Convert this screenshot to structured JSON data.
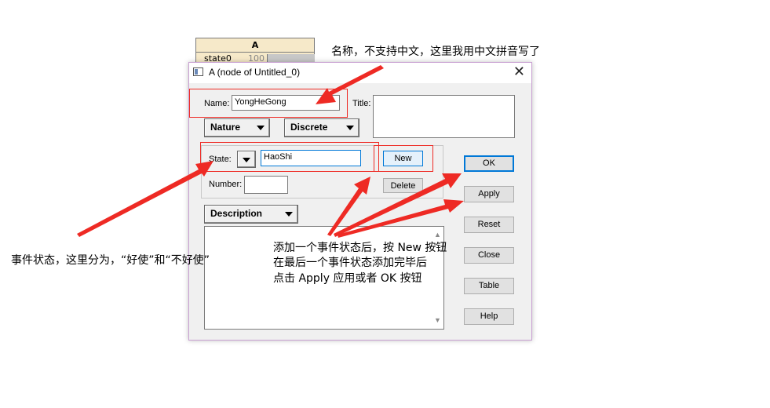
{
  "node": {
    "title": "A",
    "state_label": "state0",
    "state_value": "100"
  },
  "dialog": {
    "title": "A (node of Untitled_0)",
    "close_glyph": "✕",
    "name_label": "Name:",
    "name_value": "YongHeGong",
    "title_label": "Title:",
    "title_value": "",
    "nature_dropdown": "Nature",
    "discrete_dropdown": "Discrete",
    "state_label": "State:",
    "state_value": "HaoShi",
    "new_button": "New",
    "number_label": "Number:",
    "number_value": "",
    "delete_button": "Delete",
    "description_dropdown": "Description",
    "description_text": "",
    "buttons": {
      "ok": "OK",
      "apply": "Apply",
      "reset": "Reset",
      "close": "Close",
      "table": "Table",
      "help": "Help"
    }
  },
  "annotations": {
    "name_note": "名称，不支持中文，这里我用中文拼音写了",
    "state_note": "事件状态，这里分为，“好使”和“不好使”",
    "new_note_line1": "添加一个事件状态后，按 New 按钮",
    "new_note_line2": "在最后一个事件状态添加完毕后",
    "new_note_line3": "点击 Apply 应用或者 OK 按钮"
  },
  "colors": {
    "annotation_red": "#ee2a24",
    "default_button_border": "#0078d7",
    "node_fill": "#f6e9c9"
  }
}
